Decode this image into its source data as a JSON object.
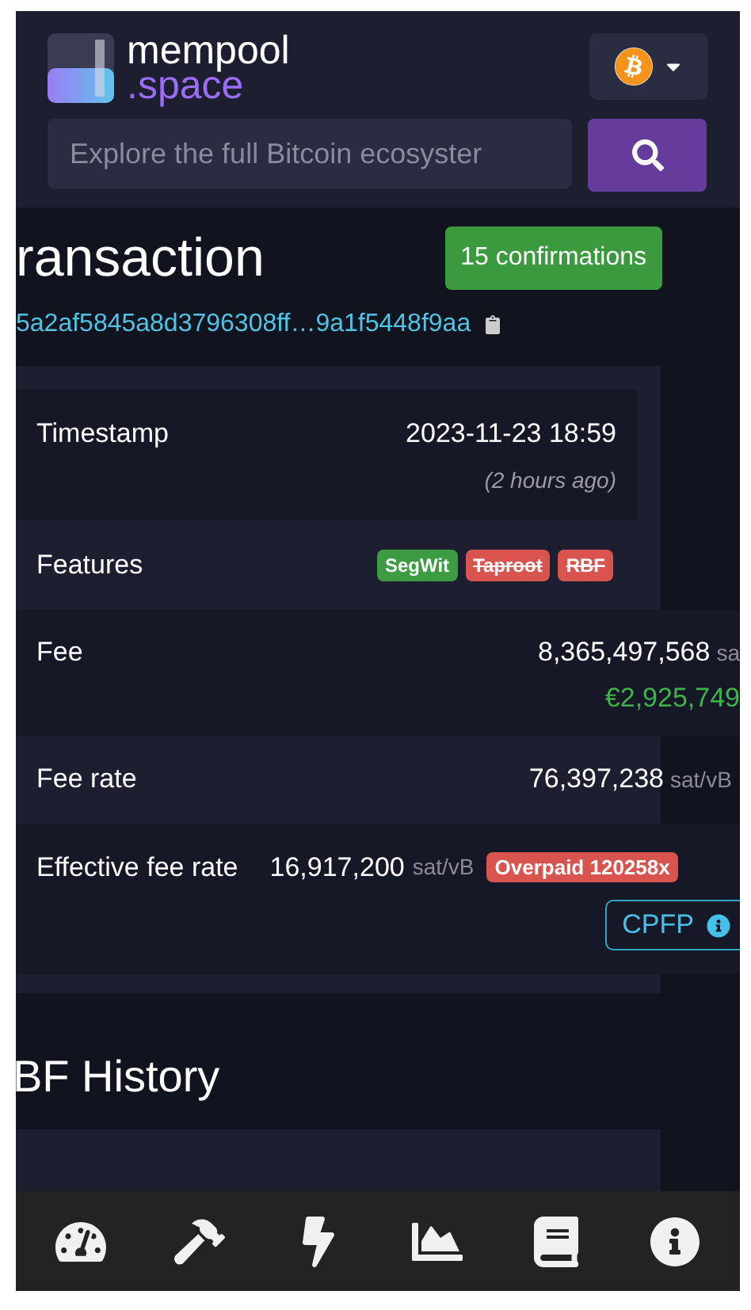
{
  "header": {
    "logo_top": "mempool",
    "logo_bottom": ".space",
    "search": {
      "placeholder": "Explore the full Bitcoin ecosyster"
    }
  },
  "title": "ransaction",
  "confirmations": "15 confirmations",
  "txid": "5a2af5845a8d3796308ff…9a1f5448f9aa",
  "rows": [
    {
      "kind": "timestamp",
      "label": "Timestamp",
      "value": "2023-11-23 18:59",
      "note": "(2 hours ago)"
    },
    {
      "kind": "badges",
      "label": "Features",
      "badges": [
        {
          "label": "SegWit",
          "color": "#3d9b41",
          "struck": false
        },
        {
          "label": "Taproot",
          "color": "#d9534f",
          "struck": true
        },
        {
          "label": "RBF",
          "color": "#d9534f",
          "struck": true
        }
      ]
    },
    {
      "kind": "amount",
      "label": "Fee",
      "value": "8,365,497,568",
      "unit": "sa",
      "fiat": "€2,925,749"
    },
    {
      "kind": "rate",
      "label": "Fee rate",
      "value": "76,397,238",
      "unit": "sat/vB"
    },
    {
      "kind": "effective",
      "label": "Effective fee rate",
      "value": "16,917,200",
      "unit": "sat/vB",
      "badge": "Overpaid 120258x",
      "button": "CPFP"
    }
  ],
  "section_title": "BF History",
  "nav": [
    {
      "kind": "gauge"
    },
    {
      "kind": "hammer"
    },
    {
      "kind": "bolt"
    },
    {
      "kind": "chart"
    },
    {
      "kind": "book"
    },
    {
      "kind": "info"
    }
  ]
}
